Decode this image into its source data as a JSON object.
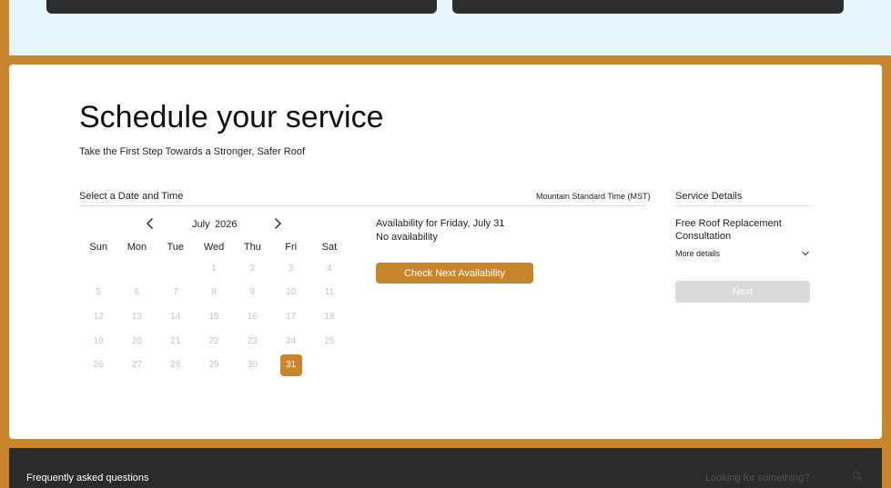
{
  "page": {
    "title": "Schedule your service",
    "subtitle": "Take the First Step Towards a Stronger, Safer Roof"
  },
  "scheduler": {
    "section_label": "Select a Date and Time",
    "timezone": "Mountain Standard Time (MST)",
    "month": "July",
    "year": "2026",
    "weekdays": [
      "Sun",
      "Mon",
      "Tue",
      "Wed",
      "Thu",
      "Fri",
      "Sat"
    ],
    "selected_day": "31",
    "weeks": [
      [
        "",
        "",
        "",
        "1",
        "2",
        "3",
        "4"
      ],
      [
        "5",
        "6",
        "7",
        "8",
        "9",
        "10",
        "11"
      ],
      [
        "12",
        "13",
        "14",
        "15",
        "16",
        "17",
        "18"
      ],
      [
        "19",
        "20",
        "21",
        "22",
        "23",
        "24",
        "25"
      ],
      [
        "26",
        "27",
        "28",
        "29",
        "30",
        "31",
        ""
      ]
    ]
  },
  "availability": {
    "title": "Availability for Friday, July 31",
    "status": "No availability",
    "check_button": "Check Next Availability"
  },
  "service_details": {
    "heading": "Service Details",
    "name": "Free Roof Replacement Consultation",
    "more_details": "More details",
    "next_button": "Next"
  },
  "footer": {
    "faq_title": "Frequently asked questions",
    "search_placeholder": "Looking for something?"
  },
  "colors": {
    "accent": "#c8852b",
    "top_band": "#e6f6fb",
    "footer": "#2b2b2b",
    "disabled_button": "#dadada"
  },
  "icons": {
    "prev": "chevron-left-icon",
    "next": "chevron-right-icon",
    "more": "chevron-down-icon",
    "search": "search-icon"
  }
}
